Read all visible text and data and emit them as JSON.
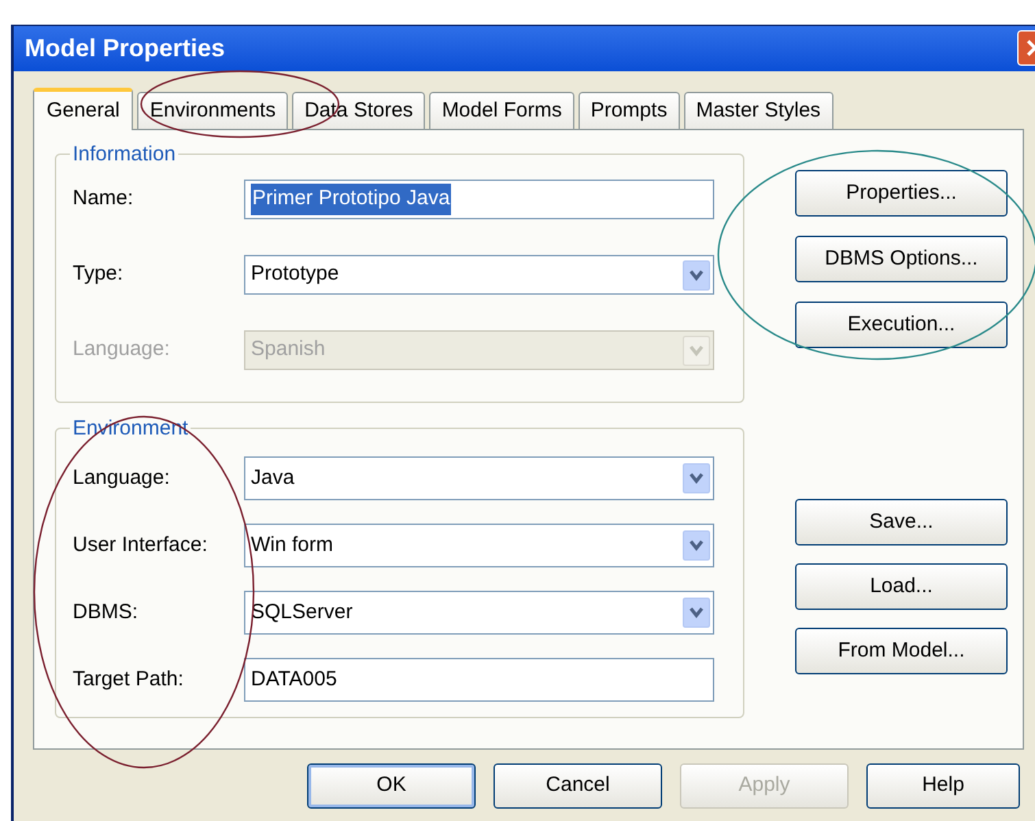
{
  "window": {
    "title": "Model Properties"
  },
  "tabs": [
    {
      "label": "General",
      "selected": true
    },
    {
      "label": "Environments",
      "selected": false
    },
    {
      "label": "Data Stores",
      "selected": false
    },
    {
      "label": "Model Forms",
      "selected": false
    },
    {
      "label": "Prompts",
      "selected": false
    },
    {
      "label": "Master Styles",
      "selected": false
    }
  ],
  "groups": [
    {
      "title": "Information",
      "fields": [
        {
          "label": "Name:",
          "kind": "text",
          "value": "Primer Prototipo Java",
          "selected": true,
          "disabled": false
        },
        {
          "label": "Type:",
          "kind": "combo",
          "value": "Prototype",
          "disabled": false
        },
        {
          "label": "Language:",
          "kind": "combo",
          "value": "Spanish",
          "disabled": true
        }
      ]
    },
    {
      "title": "Environment",
      "fields": [
        {
          "label": "Language:",
          "kind": "combo",
          "value": "Java",
          "disabled": false
        },
        {
          "label": "User Interface:",
          "kind": "combo",
          "value": "Win form",
          "disabled": false
        },
        {
          "label": "DBMS:",
          "kind": "combo",
          "value": "SQLServer",
          "disabled": false
        },
        {
          "label": "Target Path:",
          "kind": "text",
          "value": "DATA005",
          "selected": false,
          "disabled": false
        }
      ]
    }
  ],
  "side_buttons_top": [
    "Properties...",
    "DBMS Options...",
    "Execution..."
  ],
  "side_buttons_bottom": [
    "Save...",
    "Load...",
    "From Model..."
  ],
  "buttons": [
    {
      "label": "OK",
      "default": true,
      "disabled": false
    },
    {
      "label": "Cancel",
      "default": false,
      "disabled": false
    },
    {
      "label": "Apply",
      "default": false,
      "disabled": true
    },
    {
      "label": "Help",
      "default": false,
      "disabled": false
    }
  ],
  "annotations": [
    {
      "color": "#7a1f2e"
    },
    {
      "color": "#2a8a8a"
    },
    {
      "color": "#7a1f2e"
    }
  ]
}
